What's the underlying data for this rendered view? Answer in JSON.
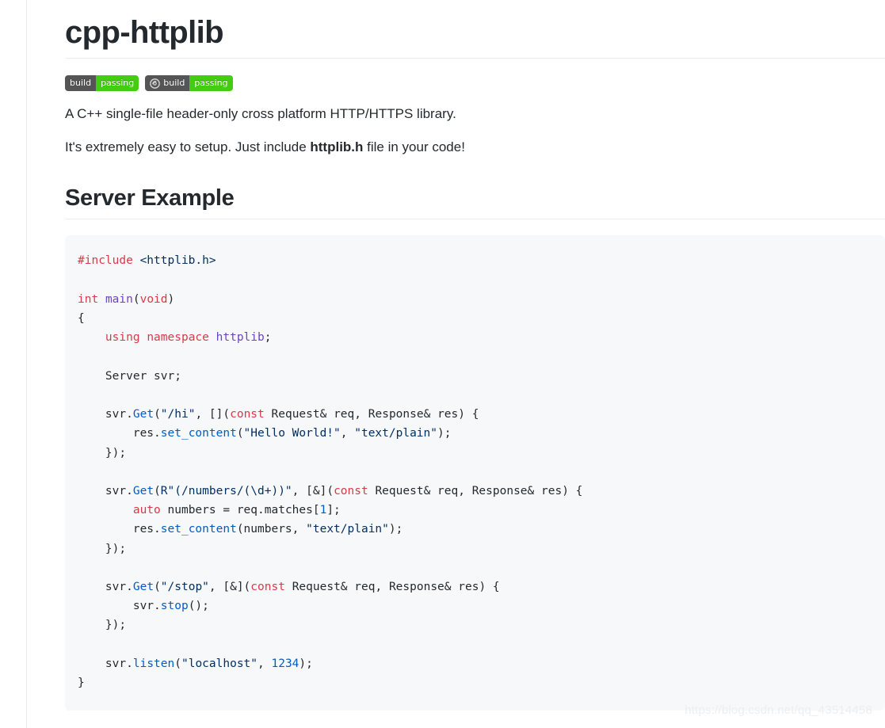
{
  "page": {
    "title": "cpp-httplib",
    "watermark": "https://blog.csdn.net/qq_43514458"
  },
  "badges": [
    {
      "name": "travis-ci-build-badge",
      "icon": null,
      "left_label": "build",
      "right_label": "passing",
      "left_color": "#555555",
      "right_color": "#44cc11"
    },
    {
      "name": "appveyor-build-badge",
      "icon": "appveyor-icon",
      "left_label": "build",
      "right_label": "passing",
      "left_color": "#555555",
      "right_color": "#44cc11"
    }
  ],
  "paragraphs": {
    "intro": "A C++ single-file header-only cross platform HTTP/HTTPS library.",
    "setup_prefix": "It's extremely easy to setup. Just include ",
    "setup_bold": "httplib.h",
    "setup_suffix": " file in your code!"
  },
  "sections": {
    "server_example_heading": "Server Example"
  },
  "code": {
    "language": "cpp",
    "lines": [
      "#include <httplib.h>",
      "",
      "int main(void)",
      "{",
      "    using namespace httplib;",
      "",
      "    Server svr;",
      "",
      "    svr.Get(\"/hi\", [](const Request& req, Response& res) {",
      "        res.set_content(\"Hello World!\", \"text/plain\");",
      "    });",
      "",
      "    svr.Get(R\"(/numbers/(\\d+))\", [&](const Request& req, Response& res) {",
      "        auto numbers = req.matches[1];",
      "        res.set_content(numbers, \"text/plain\");",
      "    });",
      "",
      "    svr.Get(\"/stop\", [&](const Request& req, Response& res) {",
      "        svr.stop();",
      "    });",
      "",
      "    svr.listen(\"localhost\", 1234);",
      "}"
    ]
  },
  "colors": {
    "keyword": "#d73a49",
    "entity": "#6f42c1",
    "function": "#005cc5",
    "string": "#032f62",
    "plain": "#24292e",
    "code_background": "#f6f8fa",
    "rule": "#eaecef"
  }
}
